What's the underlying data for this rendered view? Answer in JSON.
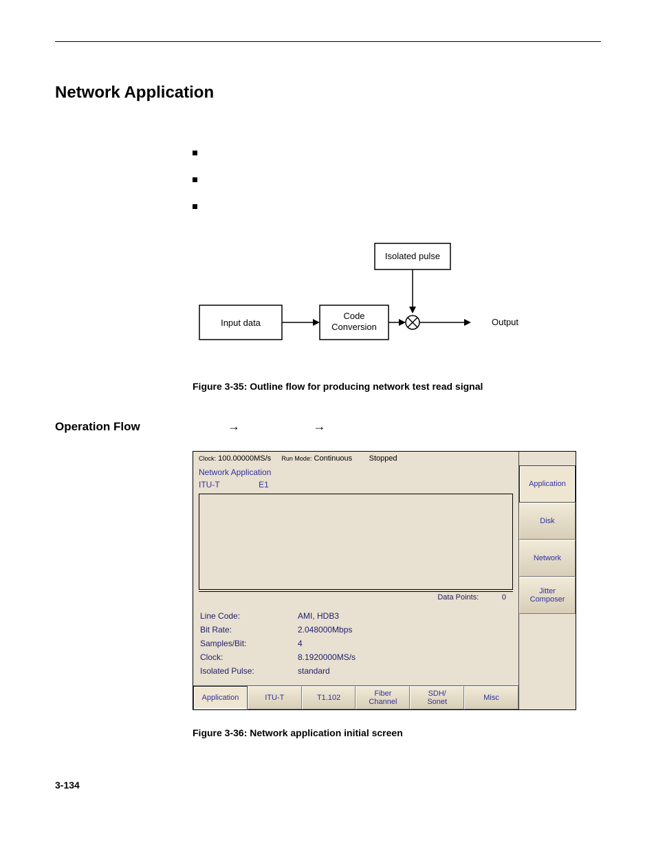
{
  "section_title": "Network Application",
  "flow": {
    "isolated_pulse": "Isolated pulse",
    "input_data": "Input data",
    "code_conversion_l1": "Code",
    "code_conversion_l2": "Conversion",
    "output": "Output"
  },
  "fig35_caption": "Figure 3-35: Outline flow for producing network test read signal",
  "operation_flow_label": "Operation Flow",
  "arrows": {
    "a1": "→",
    "a2": "→"
  },
  "screenshot": {
    "clock_label": "Clock:",
    "clock_value": "100.00000MS/s",
    "runmode_label": "Run Mode:",
    "runmode_value": "Continuous",
    "status": "Stopped",
    "app_title": "Network Application",
    "standard": "ITU-T",
    "substandard": "E1",
    "data_points_label": "Data Points:",
    "data_points_value": "0",
    "params": [
      {
        "label": "Line Code:",
        "value": "AMI, HDB3"
      },
      {
        "label": "Bit Rate:",
        "value": "2.048000Mbps"
      },
      {
        "label": "Samples/Bit:",
        "value": "4"
      },
      {
        "label": "Clock:",
        "value": "8.1920000MS/s"
      },
      {
        "label": "Isolated Pulse:",
        "value": "standard"
      }
    ],
    "bottom_tabs": [
      "Application",
      "ITU-T",
      "T1.102",
      "Fiber\nChannel",
      "SDH/\nSonet",
      "Misc"
    ],
    "side_buttons": [
      "Application",
      "Disk",
      "Network",
      "Jitter\nComposer"
    ]
  },
  "fig36_caption": "Figure 3-36: Network application initial screen",
  "page_number": "3-134"
}
